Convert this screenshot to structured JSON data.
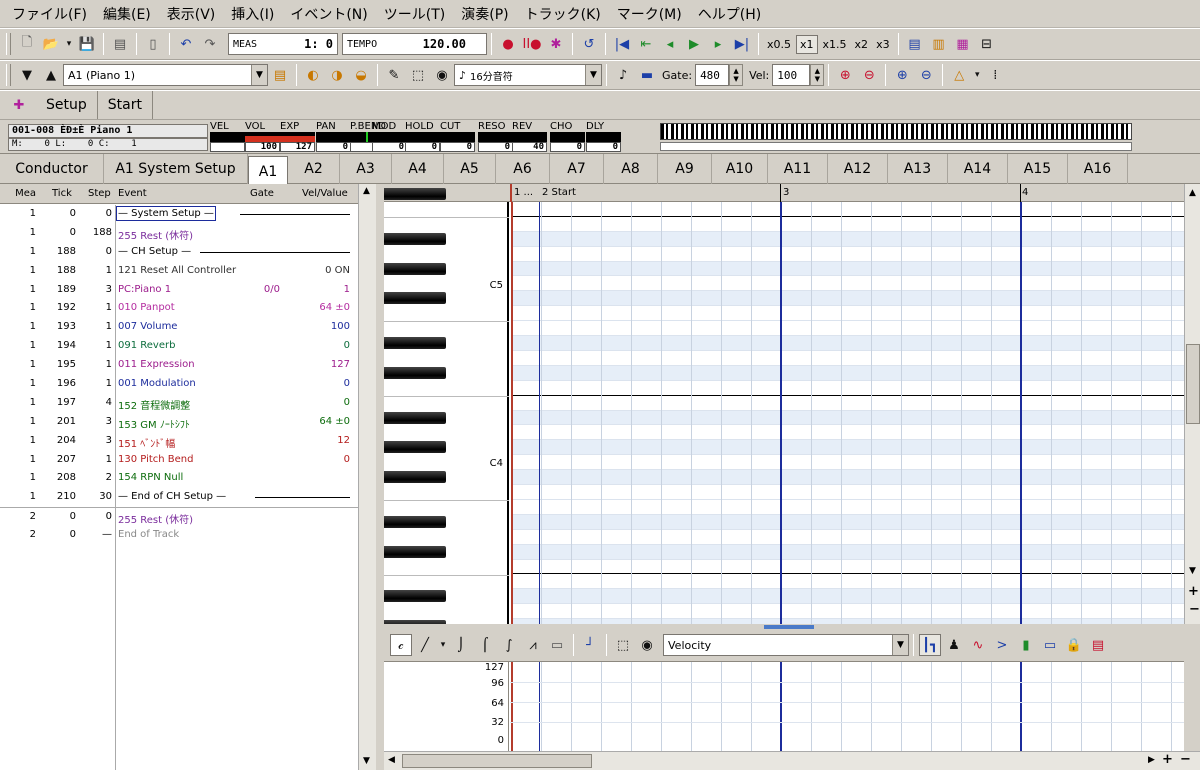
{
  "menu": [
    "ファイル(F)",
    "編集(E)",
    "表示(V)",
    "挿入(I)",
    "イベント(N)",
    "ツール(T)",
    "演奏(P)",
    "トラック(K)",
    "マーク(M)",
    "ヘルプ(H)"
  ],
  "toolbar1": {
    "meas_label": "MEAS",
    "meas_value": "1:  0",
    "tempo_label": "TEMPO",
    "tempo_value": "120.00",
    "speed_buttons": [
      "x0.5",
      "x1",
      "x1.5",
      "x2",
      "x3"
    ]
  },
  "toolbar2": {
    "track_select": "A1 (Piano 1)",
    "step_select": "16分音符",
    "gate_label": "Gate:",
    "gate_value": "480",
    "vel_label": "Vel:",
    "vel_value": "100"
  },
  "toolbar3": {
    "setup_label": "Setup",
    "start_label": "Start"
  },
  "trackinfo": {
    "name": "001-008 ÈÐ±È Piano 1",
    "position": "M:    0 L:    0 C:    1",
    "meters": [
      {
        "label": "VEL",
        "value": ""
      },
      {
        "label": "VOL",
        "value": "100"
      },
      {
        "label": "EXP",
        "value": "127"
      },
      {
        "label": "PAN",
        "value": "0"
      },
      {
        "label": "P.BEND",
        "value": "0"
      },
      {
        "label": "MOD",
        "value": "0"
      },
      {
        "label": "HOLD",
        "value": "0"
      },
      {
        "label": "CUT",
        "value": "0"
      },
      {
        "label": "RESO",
        "value": "0"
      },
      {
        "label": "REV",
        "value": "40"
      },
      {
        "label": "CHO",
        "value": "0"
      },
      {
        "label": "DLY",
        "value": "0"
      }
    ]
  },
  "tabs": [
    "Conductor",
    "A1 System Setup",
    "A1",
    "A2",
    "A3",
    "A4",
    "A5",
    "A6",
    "A7",
    "A8",
    "A9",
    "A10",
    "A11",
    "A12",
    "A13",
    "A14",
    "A15",
    "A16"
  ],
  "event_list": {
    "headers": {
      "mea": "Mea",
      "tick": "Tick",
      "step": "Step",
      "event": "Event",
      "gate": "Gate",
      "value": "Vel/Value"
    },
    "rows": [
      {
        "mea": "1",
        "tick": "0",
        "step": "0",
        "event": "— System Setup —",
        "gate": "",
        "value": "",
        "color": "#000000"
      },
      {
        "mea": "1",
        "tick": "0",
        "step": "188",
        "event": "255 Rest (休符)",
        "gate": "",
        "value": "",
        "color": "#7a2c9c"
      },
      {
        "mea": "1",
        "tick": "188",
        "step": "0",
        "event": "— CH Setup —",
        "gate": "",
        "value": "",
        "color": "#000000"
      },
      {
        "mea": "1",
        "tick": "188",
        "step": "1",
        "event": "121 Reset All Controller",
        "gate": "",
        "value": "0  ON",
        "color": "#303030"
      },
      {
        "mea": "1",
        "tick": "189",
        "step": "3",
        "event": "PC:Piano 1",
        "gate": "0/0",
        "value": "1",
        "color": "#9c1c8c"
      },
      {
        "mea": "1",
        "tick": "192",
        "step": "1",
        "event": "010 Panpot",
        "gate": "",
        "value": "64  ±0",
        "color": "#b42ca0"
      },
      {
        "mea": "1",
        "tick": "193",
        "step": "1",
        "event": "007 Volume",
        "gate": "",
        "value": "100",
        "color": "#1c2c9c"
      },
      {
        "mea": "1",
        "tick": "194",
        "step": "1",
        "event": "091 Reverb",
        "gate": "",
        "value": "0",
        "color": "#0c6c3c"
      },
      {
        "mea": "1",
        "tick": "195",
        "step": "1",
        "event": "011 Expression",
        "gate": "",
        "value": "127",
        "color": "#9c1c8c"
      },
      {
        "mea": "1",
        "tick": "196",
        "step": "1",
        "event": "001 Modulation",
        "gate": "",
        "value": "0",
        "color": "#1c2c9c"
      },
      {
        "mea": "1",
        "tick": "197",
        "step": "4",
        "event": "152 音程微調整",
        "gate": "",
        "value": "0",
        "color": "#0c6c0c"
      },
      {
        "mea": "1",
        "tick": "201",
        "step": "3",
        "event": "153 GM ﾉｰﾄｼﾌﾄ",
        "gate": "",
        "value": "64  ±0",
        "color": "#0c6c0c"
      },
      {
        "mea": "1",
        "tick": "204",
        "step": "3",
        "event": "151 ﾍﾞﾝﾄﾞ幅",
        "gate": "",
        "value": "12",
        "color": "#b41c1c"
      },
      {
        "mea": "1",
        "tick": "207",
        "step": "1",
        "event": "130 Pitch Bend",
        "gate": "",
        "value": "0",
        "color": "#b41c1c"
      },
      {
        "mea": "1",
        "tick": "208",
        "step": "2",
        "event": "154 RPN Null",
        "gate": "",
        "value": "",
        "color": "#0c6c0c"
      },
      {
        "mea": "1",
        "tick": "210",
        "step": "30",
        "event": "— End of CH Setup —",
        "gate": "",
        "value": "",
        "color": "#000000"
      },
      {
        "mea": "2",
        "tick": "0",
        "step": "0",
        "event": "255 Rest (休符)",
        "gate": "",
        "value": "",
        "color": "#7a2c9c"
      },
      {
        "mea": "2",
        "tick": "0",
        "step": "—",
        "event": "End of Track",
        "gate": "",
        "value": "",
        "color": "#888888"
      }
    ]
  },
  "piano_roll": {
    "ruler": [
      "1 ...",
      "2 Start",
      "3",
      "4"
    ],
    "key_labels": [
      "C5",
      "C4"
    ]
  },
  "velocity_panel": {
    "select": "Velocity",
    "scale": [
      "127",
      "96",
      "64",
      "32",
      "0"
    ]
  }
}
